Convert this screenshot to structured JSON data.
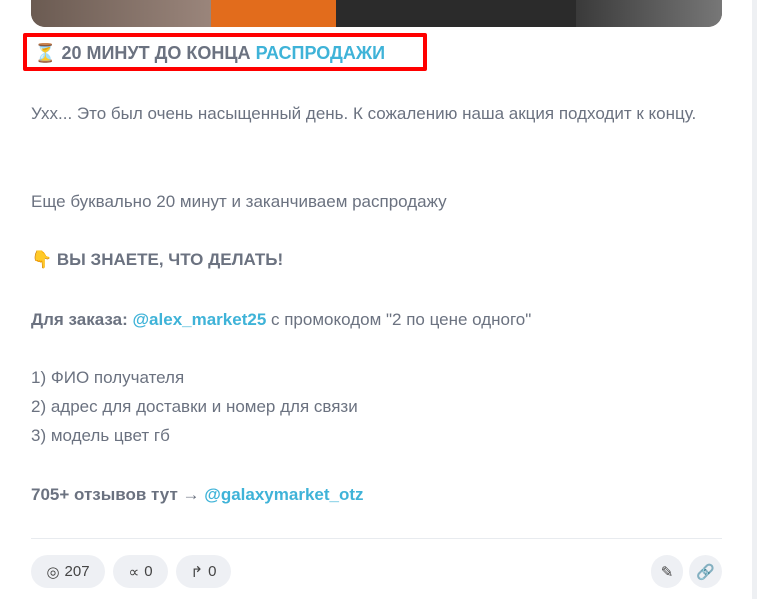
{
  "post": {
    "title_a": "20 МИНУТ ДО КОНЦА",
    "title_b": "РАСПРОДАЖИ",
    "p1": "Ухх... Это был очень насыщенный день. К сожалению наша акция подходит к концу.",
    "p2": "Еще буквально 20 минут и заканчиваем распродажу",
    "p3": "ВЫ ЗНАЕТЕ, ЧТО ДЕЛАТЬ!",
    "order_label": "Для заказа:",
    "order_link": "@alex_market25",
    "order_rest": " с промокодом \"2 по цене одного\"",
    "list": [
      "1) ФИО получателя",
      "2) адрес для доставки и номер для связи",
      "3) модель цвет гб"
    ],
    "reviews": "705+ отзывов тут →",
    "reviews_link": "@galaxymarket_otz"
  },
  "stats": {
    "views": "207",
    "shares": "0",
    "forwards": "0"
  }
}
